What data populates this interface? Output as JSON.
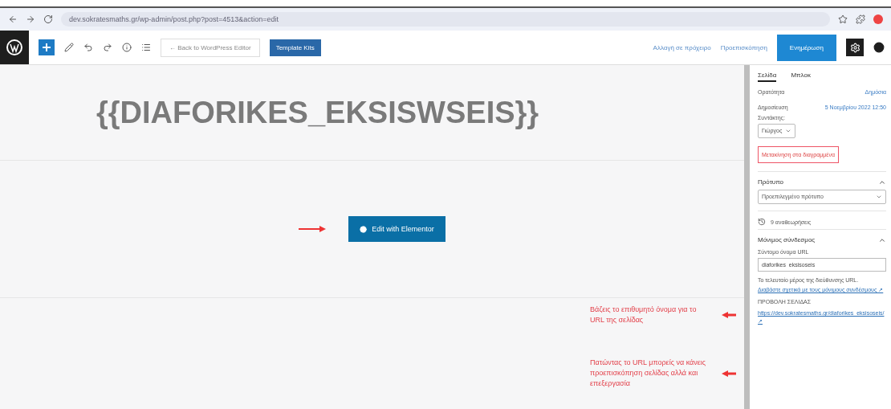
{
  "browser": {
    "url": "dev.sokratesmaths.gr/wp-admin/post.php?post=4513&action=edit"
  },
  "toolbar": {
    "back_button": "← Back to WordPress Editor",
    "kits_button": "Template Kits",
    "draft_link": "Αλλαγή σε πρόχειρο",
    "preview_link": "Προεπισκόπηση",
    "update_button": "Ενημέρωση"
  },
  "editor": {
    "title": "{{DIAFORIKES_EKSISWSEIS}}",
    "elementor_button": "Edit with Elementor"
  },
  "annotations": [
    {
      "text": "Βάζεις το επιθυμητό όνομα για το URL της σελίδας"
    },
    {
      "text": "Πατώντας το URL μπορείς να κάνεις προεπισκόπηση σελίδας αλλά και επεξεργασία"
    }
  ],
  "sidebar": {
    "tabs": [
      {
        "label": "Σελίδα",
        "selected": true
      },
      {
        "label": "Μπλοκ",
        "selected": false
      }
    ],
    "rows": [
      {
        "label": "Ορατότητα",
        "value": "Δημόσια"
      },
      {
        "label": "Δημοσίευση",
        "value": "5 Νοεμβρίου 2022 12:50"
      }
    ],
    "author_label": "Συντάκτης:",
    "author_value": "Γιώργος",
    "trash_button": "Μετακίνηση στα διαγραμμένα",
    "template": {
      "title": "Πρότυπο",
      "expanded": true,
      "value": "Προεπιλεγμένο πρότυπο"
    },
    "revisions": "9 αναθεωρήσεις",
    "permalink": {
      "title": "Μόνιμος σύνδεσμος",
      "expanded": true,
      "slug_label": "Σύντομο όνομα URL",
      "slug_value": "diaforikes_eksisoseis",
      "help": "Το τελευταίο μέρος της διεύθυνσης URL.",
      "help_link": "Διαβάστε σχετικά με τους μόνιμους συνδέσμους ↗",
      "view_label": "ΠΡΟΒΟΛΗ ΣΕΛΙΔΑΣ",
      "url": "https://dev.sokratesmaths.gr/diaforikes_eksisoseis/ ↗"
    }
  }
}
